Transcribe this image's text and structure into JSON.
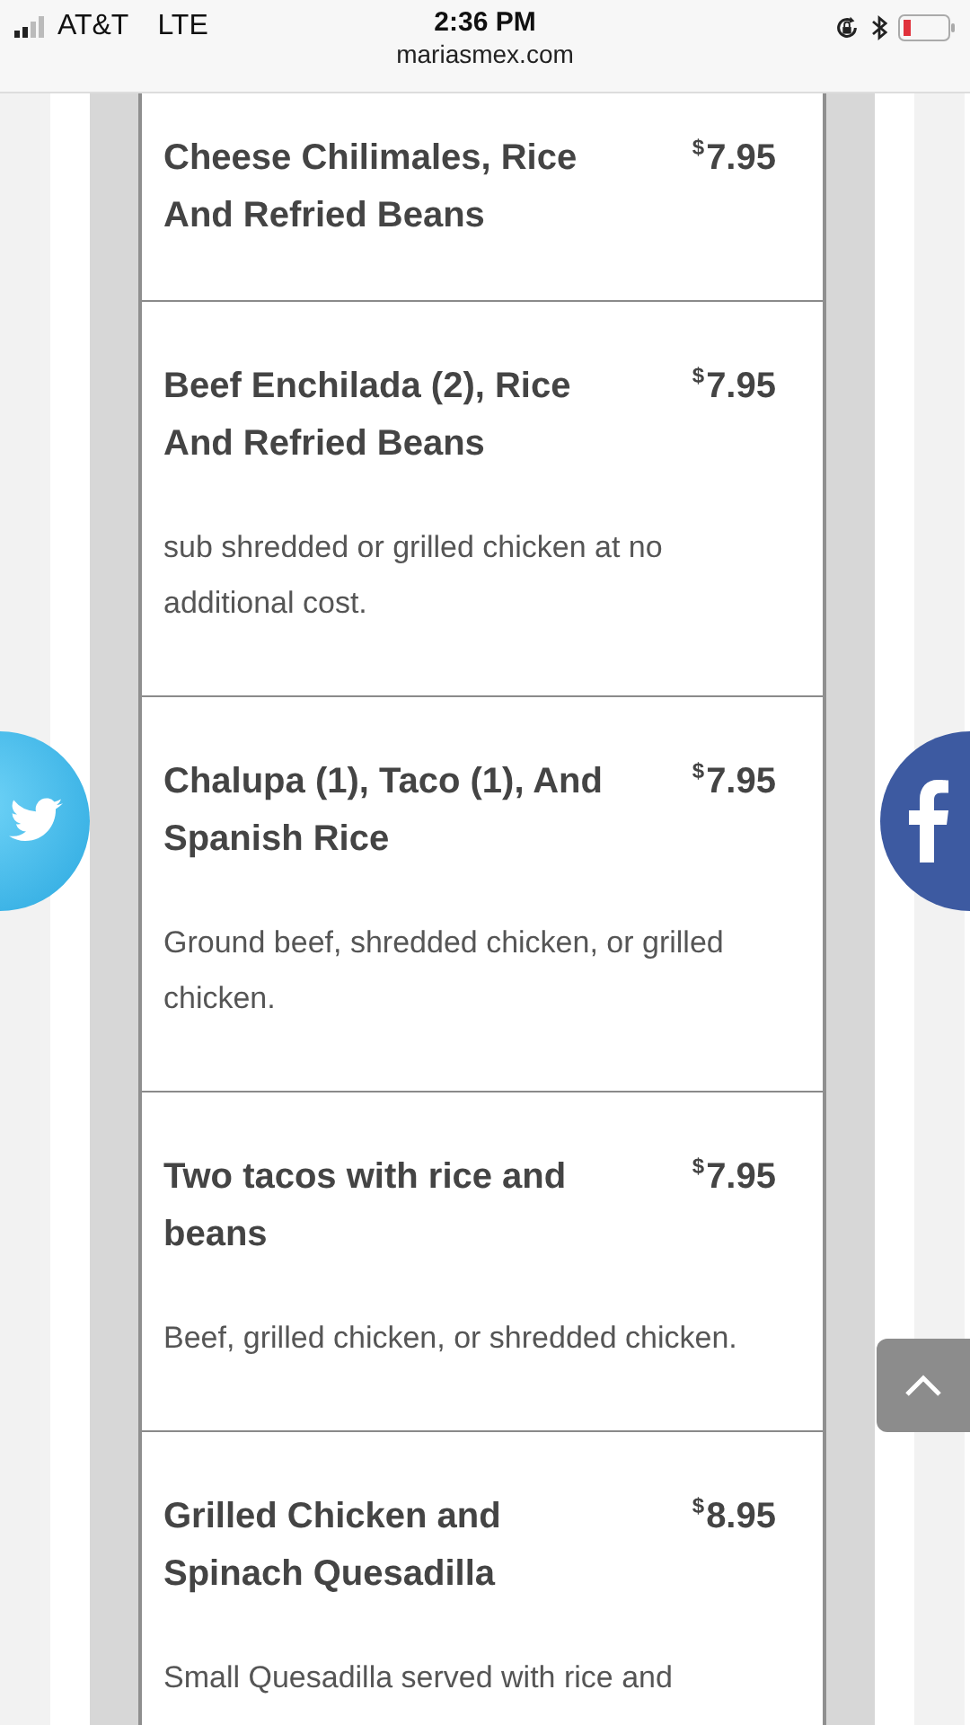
{
  "status_bar": {
    "carrier": "AT&T",
    "network": "LTE",
    "time": "2:36 PM",
    "url": "mariasmex.com"
  },
  "menu_items": [
    {
      "title": "Cheese Chilimales, Rice And Refried Beans",
      "currency": "$",
      "amount": "7.95"
    },
    {
      "title": "Beef Enchilada (2), Rice And Refried Beans",
      "currency": "$",
      "amount": "7.95",
      "description": "sub shredded or grilled chicken at no additional cost."
    },
    {
      "title": "Chalupa (1), Taco (1), And Spanish Rice",
      "currency": "$",
      "amount": "7.95",
      "description": "Ground beef, shredded chicken, or grilled chicken."
    },
    {
      "title": "Two tacos with rice and beans",
      "currency": "$",
      "amount": "7.95",
      "description": "Beef, grilled chicken, or shredded chicken."
    },
    {
      "title": "Grilled Chicken and Spinach Quesadilla",
      "currency": "$",
      "amount": "8.95",
      "description": "Small Quesadilla served with rice and"
    }
  ]
}
